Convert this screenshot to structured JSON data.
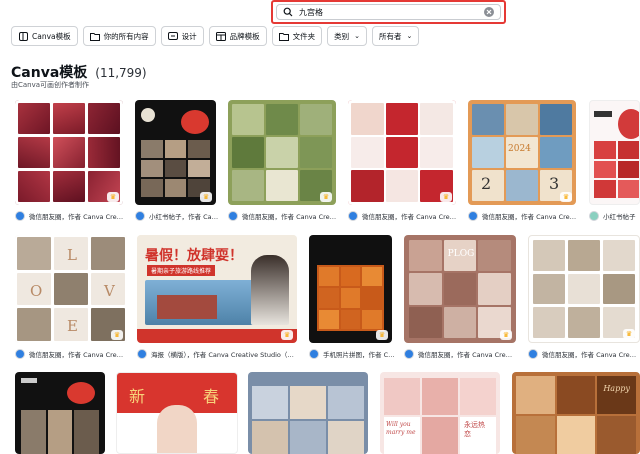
{
  "search": {
    "value": "九宫格"
  },
  "filters": [
    {
      "label": "Canva模板",
      "icon": "template-icon"
    },
    {
      "label": "你的所有内容",
      "icon": "folder-icon"
    },
    {
      "label": "设计",
      "icon": "design-icon"
    },
    {
      "label": "品牌模板",
      "icon": "brand-icon"
    },
    {
      "label": "文件夹",
      "icon": "folder-icon"
    },
    {
      "label": "类别",
      "icon": "",
      "dropdown": true
    },
    {
      "label": "所有者",
      "icon": "",
      "dropdown": true
    }
  ],
  "section": {
    "title": "Canva模板",
    "count": "(11,799)",
    "subtitle": "由Canva可画创作者制作"
  },
  "row1": [
    {
      "caption": "微信朋友圈，作者 Canva Creati..."
    },
    {
      "caption": "小红书帖子，作者 Canva Creat..."
    },
    {
      "caption": "微信朋友圈，作者 Canva Creati..."
    },
    {
      "caption": "微信朋友圈，作者 Canva Creati..."
    },
    {
      "caption": "微信朋友圈，作者 Canva Creative..."
    },
    {
      "caption": "小红书帖子"
    }
  ],
  "row2": [
    {
      "caption": "微信朋友圈，作者 Canva Creative..."
    },
    {
      "caption": "海报（横版），作者 Canva Creative Studio（可画..."
    },
    {
      "caption": "手机照片拼图，作者 Canva C..."
    },
    {
      "caption": "微信朋友圈，作者 Canva Creative..."
    },
    {
      "caption": "微信朋友圈，作者 Canva Creative..."
    }
  ],
  "covers": {
    "love_letters": [
      "L",
      "O",
      "V",
      "E"
    ],
    "poster_title": "暑假！放肆耍！",
    "poster_sub": "暑期亲子旅游路线推荐",
    "ploc": "PLOG",
    "year": "2024",
    "year_digits": [
      "2",
      "3"
    ],
    "spring": [
      "新",
      "春"
    ],
    "will_you": "Will you marry me",
    "forever": "永远热恋",
    "happy": "Happy"
  },
  "colors": {
    "accent": "#e53935",
    "crown": "#f7a600"
  }
}
